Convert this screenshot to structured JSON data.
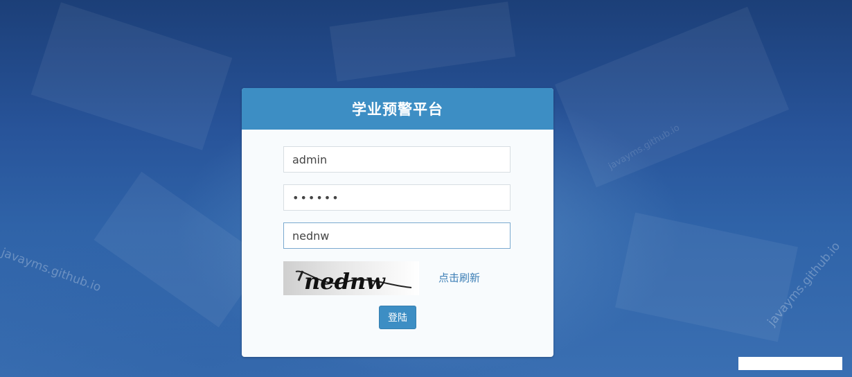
{
  "login": {
    "title": "学业预警平台",
    "username_value": "admin",
    "password_value": "••••••",
    "captcha_value": "nednw",
    "captcha_image_text": "nednw",
    "refresh_label": "点击刷新",
    "submit_label": "登陆"
  },
  "watermark": {
    "text": "javayms.github.io"
  },
  "colors": {
    "header": "#3d8ec4",
    "button": "#3d8ec4",
    "link": "#3d7fb6",
    "panel": "#f8fbfd"
  }
}
